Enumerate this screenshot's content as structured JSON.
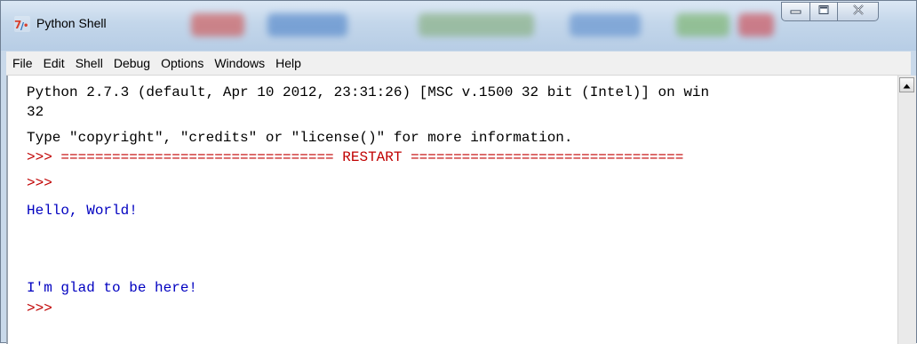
{
  "window": {
    "title": "Python Shell",
    "controls": {
      "minimize": "minimize",
      "maximize": "maximize",
      "close": "close"
    }
  },
  "menu": {
    "items": [
      "File",
      "Edit",
      "Shell",
      "Debug",
      "Options",
      "Windows",
      "Help"
    ]
  },
  "shell": {
    "lines": [
      {
        "text": "Python 2.7.3 (default, Apr 10 2012, 23:31:26) [MSC v.1500 32 bit (Intel)] on win",
        "color": "black"
      },
      {
        "text": "32",
        "color": "black"
      },
      {
        "text": "Type \"copyright\", \"credits\" or \"license()\" for more information.",
        "color": "black"
      },
      {
        "text": ">>> ================================ RESTART ================================",
        "color": "red"
      },
      {
        "text": ">>>",
        "color": "red"
      },
      {
        "text": "Hello, World!",
        "color": "blue"
      },
      {
        "text": "",
        "color": "blue"
      },
      {
        "text": "",
        "color": "blue"
      },
      {
        "text": "I'm glad to be here!",
        "color": "blue"
      },
      {
        "text": ">>>",
        "color": "red"
      }
    ]
  },
  "icons": {
    "app": "idle-python-icon",
    "minimize": "minimize-icon",
    "maximize": "maximize-icon",
    "close": "close-x-icon",
    "scroll_up": "scroll-up-arrow-icon"
  },
  "colors": {
    "prompt": "#c00000",
    "output": "#0000c0",
    "text": "#000000",
    "chrome": "#c9d9ea"
  }
}
